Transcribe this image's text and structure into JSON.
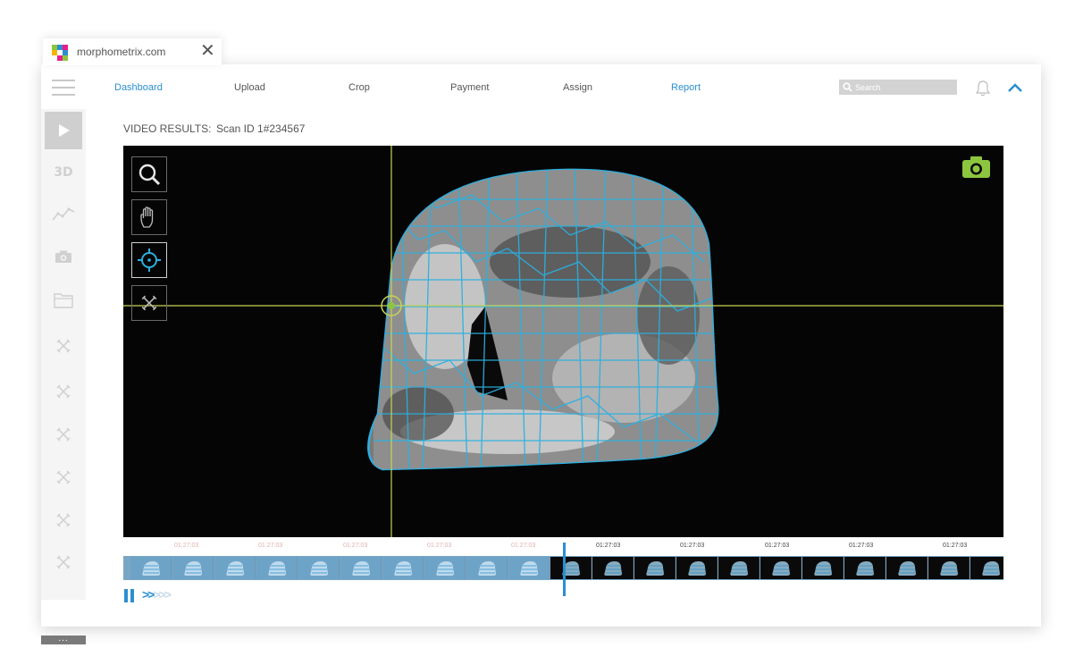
{
  "browser_tab": {
    "title": "morphometrix.com",
    "favicon": "morphometrix-logo-icon",
    "close_icon": "close-icon"
  },
  "nav": {
    "items": [
      {
        "label": "Dashboard",
        "active": true
      },
      {
        "label": "Upload",
        "active": false
      },
      {
        "label": "Crop",
        "active": false
      },
      {
        "label": "Payment",
        "active": false
      },
      {
        "label": "Assign",
        "active": false
      },
      {
        "label": "Report",
        "active": true
      }
    ],
    "search_placeholder": "Search",
    "icons": [
      "menu-icon",
      "search-icon",
      "bell-icon",
      "chevron-up-icon"
    ]
  },
  "sidebar": {
    "items": [
      {
        "icon": "play-icon",
        "active": true
      },
      {
        "icon": "3d-icon",
        "label": "3D"
      },
      {
        "icon": "line-chart-icon"
      },
      {
        "icon": "camera-icon"
      },
      {
        "icon": "folder-icon"
      },
      {
        "icon": "tools-icon"
      },
      {
        "icon": "tools-icon"
      },
      {
        "icon": "tools-icon"
      },
      {
        "icon": "tools-icon"
      },
      {
        "icon": "tools-icon"
      },
      {
        "icon": "tools-icon"
      }
    ],
    "more_label": "..."
  },
  "results": {
    "heading": "VIDEO RESULTS:",
    "scan_id": "Scan ID 1#234567"
  },
  "viewer": {
    "tools": [
      "zoom-icon",
      "hand-icon",
      "crosshair-icon",
      "tools-icon"
    ],
    "active_tool": "crosshair-icon",
    "snapshot_icon": "camera-icon",
    "accent_colors": {
      "outline": "#2bb0e0",
      "crosshair": "#c8d455",
      "camera": "#8cc63f"
    }
  },
  "timeline": {
    "timestamps": [
      "01:27:03",
      "01:27:03",
      "01:27:03",
      "01:27:03",
      "01:27:03",
      "01:27:03",
      "01:27:03",
      "01:27:03",
      "01:27:03",
      "01:27:03"
    ],
    "progress": 0.5,
    "controls": {
      "pause_icon": "pause-icon",
      "forward_icon": "fast-forward-icon"
    }
  }
}
